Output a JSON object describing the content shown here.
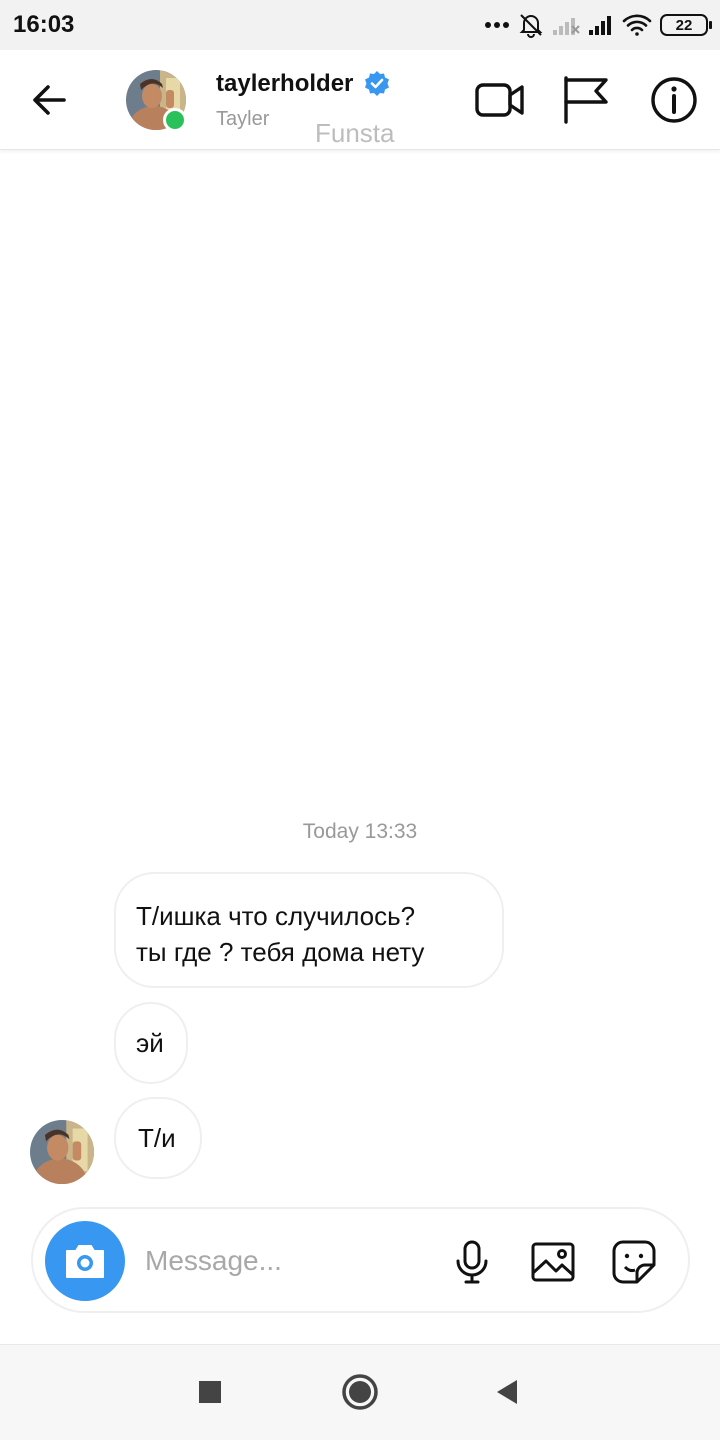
{
  "status_bar": {
    "time": "16:03",
    "battery": "22",
    "icons": [
      "more-dots-icon",
      "mute-bell-icon",
      "no-signal-icon",
      "signal-icon",
      "wifi-icon",
      "battery-icon"
    ]
  },
  "header": {
    "username": "taylerholder",
    "display_name": "Tayler",
    "overlay_text": "Funsta",
    "verified": true,
    "online": true,
    "icons": [
      "back-arrow-icon",
      "video-call-icon",
      "flag-icon",
      "info-icon"
    ]
  },
  "conversation": {
    "timestamp": "Today 13:33",
    "messages": [
      {
        "line1": "Т/ишка что случилось?",
        "line2": "ты где ? тебя дома нету"
      },
      {
        "text": "эй"
      },
      {
        "text": "Т/и"
      }
    ]
  },
  "composer": {
    "placeholder": "Message...",
    "icons": [
      "camera-icon",
      "microphone-icon",
      "gallery-icon",
      "sticker-icon"
    ]
  },
  "nav_bar": {
    "icons": [
      "recents-square-icon",
      "home-circle-icon",
      "back-triangle-icon"
    ]
  },
  "colors": {
    "accent": "#3897f0",
    "online": "#2bc15a",
    "verified": "#3897f0",
    "bubble_border": "#efefef",
    "secondary_text": "#999999"
  }
}
